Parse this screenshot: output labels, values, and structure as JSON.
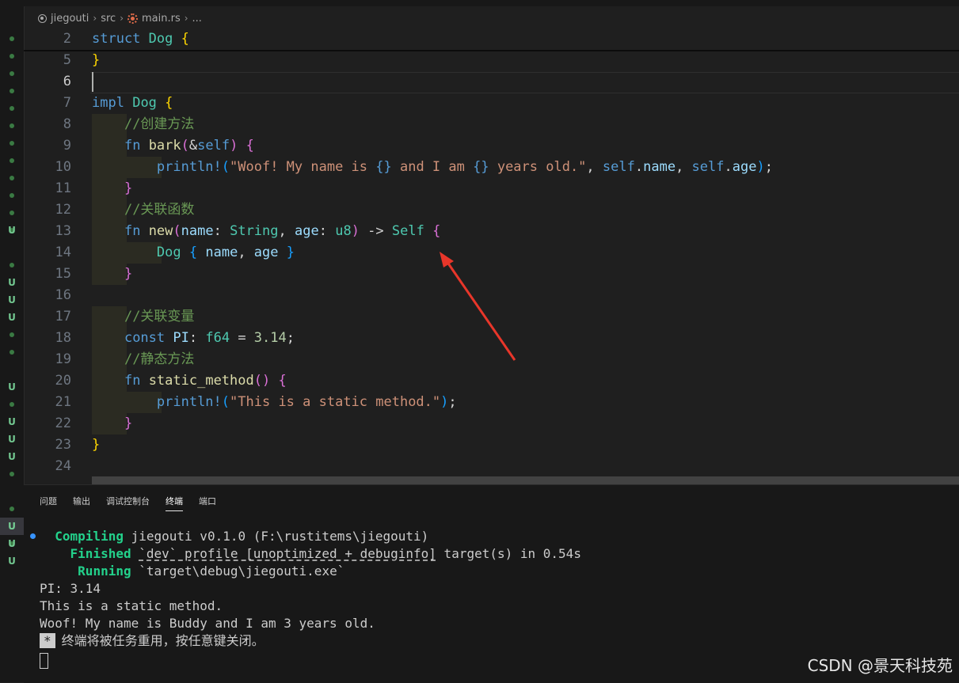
{
  "breadcrumb": {
    "project": "jiegouti",
    "folder": "src",
    "file": "main.rs",
    "more": "..."
  },
  "editor": {
    "lines": [
      {
        "num": "2",
        "sticky": true,
        "tokens": [
          [
            "kw",
            "struct"
          ],
          [
            "pun",
            " "
          ],
          [
            "ty",
            "Dog"
          ],
          [
            "pun",
            " "
          ],
          [
            "b1",
            "{"
          ]
        ]
      },
      {
        "num": "5",
        "tokens": [
          [
            "b1",
            "}"
          ]
        ]
      },
      {
        "num": "6",
        "current": true,
        "tokens": []
      },
      {
        "num": "7",
        "tokens": [
          [
            "kw",
            "impl"
          ],
          [
            "pun",
            " "
          ],
          [
            "ty",
            "Dog"
          ],
          [
            "pun",
            " "
          ],
          [
            "b1",
            "{"
          ]
        ]
      },
      {
        "num": "8",
        "indent": 1,
        "tokens": [
          [
            "pun",
            "    "
          ],
          [
            "cm",
            "//创建方法"
          ]
        ]
      },
      {
        "num": "9",
        "indent": 1,
        "tokens": [
          [
            "pun",
            "    "
          ],
          [
            "kw",
            "fn"
          ],
          [
            "pun",
            " "
          ],
          [
            "fn",
            "bark"
          ],
          [
            "b2",
            "("
          ],
          [
            "pun",
            "&"
          ],
          [
            "kw",
            "self"
          ],
          [
            "b2",
            ")"
          ],
          [
            "pun",
            " "
          ],
          [
            "b2",
            "{"
          ]
        ]
      },
      {
        "num": "10",
        "indent": 2,
        "tokens": [
          [
            "pun",
            "        "
          ],
          [
            "mac",
            "println!"
          ],
          [
            "b3",
            "("
          ],
          [
            "str",
            "\"Woof! My name is "
          ],
          [
            "kw",
            "{}"
          ],
          [
            "str",
            " and I am "
          ],
          [
            "kw",
            "{}"
          ],
          [
            "str",
            " years old.\""
          ],
          [
            "pun",
            ", "
          ],
          [
            "kw",
            "self"
          ],
          [
            "pun",
            "."
          ],
          [
            "var",
            "name"
          ],
          [
            "pun",
            ", "
          ],
          [
            "kw",
            "self"
          ],
          [
            "pun",
            "."
          ],
          [
            "var",
            "age"
          ],
          [
            "b3",
            ")"
          ],
          [
            "pun",
            ";"
          ]
        ]
      },
      {
        "num": "11",
        "indent": 1,
        "tokens": [
          [
            "pun",
            "    "
          ],
          [
            "b2",
            "}"
          ]
        ]
      },
      {
        "num": "12",
        "indent": 1,
        "tokens": [
          [
            "pun",
            "    "
          ],
          [
            "cm",
            "//关联函数"
          ]
        ]
      },
      {
        "num": "13",
        "indent": 1,
        "tokens": [
          [
            "pun",
            "    "
          ],
          [
            "kw",
            "fn"
          ],
          [
            "pun",
            " "
          ],
          [
            "fn",
            "new"
          ],
          [
            "b2",
            "("
          ],
          [
            "var",
            "name"
          ],
          [
            "pun",
            ": "
          ],
          [
            "ty",
            "String"
          ],
          [
            "pun",
            ", "
          ],
          [
            "var",
            "age"
          ],
          [
            "pun",
            ": "
          ],
          [
            "ty",
            "u8"
          ],
          [
            "b2",
            ")"
          ],
          [
            "pun",
            " -> "
          ],
          [
            "ty",
            "Self"
          ],
          [
            "pun",
            " "
          ],
          [
            "b2",
            "{"
          ]
        ]
      },
      {
        "num": "14",
        "indent": 2,
        "tokens": [
          [
            "pun",
            "        "
          ],
          [
            "ty",
            "Dog"
          ],
          [
            "pun",
            " "
          ],
          [
            "b3",
            "{"
          ],
          [
            "pun",
            " "
          ],
          [
            "var",
            "name"
          ],
          [
            "pun",
            ", "
          ],
          [
            "var",
            "age"
          ],
          [
            "pun",
            " "
          ],
          [
            "b3",
            "}"
          ]
        ]
      },
      {
        "num": "15",
        "indent": 1,
        "tokens": [
          [
            "pun",
            "    "
          ],
          [
            "b2",
            "}"
          ]
        ]
      },
      {
        "num": "16",
        "tokens": []
      },
      {
        "num": "17",
        "indent": 1,
        "tokens": [
          [
            "pun",
            "    "
          ],
          [
            "cm",
            "//关联变量"
          ]
        ]
      },
      {
        "num": "18",
        "indent": 1,
        "tokens": [
          [
            "pun",
            "    "
          ],
          [
            "kw",
            "const"
          ],
          [
            "pun",
            " "
          ],
          [
            "var",
            "PI"
          ],
          [
            "pun",
            ": "
          ],
          [
            "ty",
            "f64"
          ],
          [
            "pun",
            " = "
          ],
          [
            "num",
            "3.14"
          ],
          [
            "pun",
            ";"
          ]
        ]
      },
      {
        "num": "19",
        "indent": 1,
        "tokens": [
          [
            "pun",
            "    "
          ],
          [
            "cm",
            "//静态方法"
          ]
        ]
      },
      {
        "num": "20",
        "indent": 1,
        "tokens": [
          [
            "pun",
            "    "
          ],
          [
            "kw",
            "fn"
          ],
          [
            "pun",
            " "
          ],
          [
            "fn",
            "static_method"
          ],
          [
            "b2",
            "()"
          ],
          [
            "pun",
            " "
          ],
          [
            "b2",
            "{"
          ]
        ]
      },
      {
        "num": "21",
        "indent": 2,
        "tokens": [
          [
            "pun",
            "        "
          ],
          [
            "mac",
            "println!"
          ],
          [
            "b3",
            "("
          ],
          [
            "str",
            "\"This is a static method.\""
          ],
          [
            "b3",
            ")"
          ],
          [
            "pun",
            ";"
          ]
        ]
      },
      {
        "num": "22",
        "indent": 1,
        "tokens": [
          [
            "pun",
            "    "
          ],
          [
            "b2",
            "}"
          ]
        ]
      },
      {
        "num": "23",
        "tokens": [
          [
            "b1",
            "}"
          ]
        ]
      },
      {
        "num": "24",
        "tokens": []
      }
    ]
  },
  "gutter_marks": [
    {
      "t": "dot"
    },
    {
      "t": "dot"
    },
    {
      "t": "dot"
    },
    {
      "t": "dot"
    },
    {
      "t": "dot"
    },
    {
      "t": "dot"
    },
    {
      "t": "dot"
    },
    {
      "t": "dot"
    },
    {
      "t": "dot"
    },
    {
      "t": "dot"
    },
    {
      "t": "dot"
    },
    {
      "t": "dot"
    },
    {
      "t": "U"
    },
    {
      "t": "dot"
    },
    {
      "t": "U"
    },
    {
      "t": "U"
    },
    {
      "t": "U"
    },
    {
      "t": "dot"
    },
    {
      "t": "dot"
    },
    {
      "t": "U"
    },
    {
      "t": "dot"
    },
    {
      "t": "U"
    },
    {
      "t": "U"
    },
    {
      "t": "U"
    },
    {
      "t": "dot"
    },
    {
      "t": "dot"
    },
    {
      "t": "U",
      "sel": true
    },
    {
      "t": "dot"
    },
    {
      "t": "U"
    },
    {
      "t": "U"
    },
    {
      "t": "U"
    }
  ],
  "panel": {
    "tabs": [
      {
        "label": "问题",
        "active": false
      },
      {
        "label": "输出",
        "active": false
      },
      {
        "label": "调试控制台",
        "active": false
      },
      {
        "label": "终端",
        "active": true
      },
      {
        "label": "端口",
        "active": false
      }
    ],
    "terminal": {
      "compiling_label": "Compiling",
      "compiling_text": "jiegouti v0.1.0 (F:\\rustitems\\jiegouti)",
      "finished_label": "Finished",
      "finished_profile": "`dev` profile [unoptimized + debuginfo]",
      "finished_rest": " target(s) in 0.54s",
      "running_label": "Running",
      "running_text": "`target\\debug\\jiegouti.exe`",
      "output": [
        "PI: 3.14",
        "This is a static method.",
        "Woof! My name is Buddy and I am 3 years old."
      ],
      "reuse_star": "*",
      "reuse_msg": "终端将被任务重用，按任意键关闭。"
    }
  },
  "watermark": "CSDN @景天科技苑",
  "colors": {
    "arrow": "#e8362a"
  }
}
